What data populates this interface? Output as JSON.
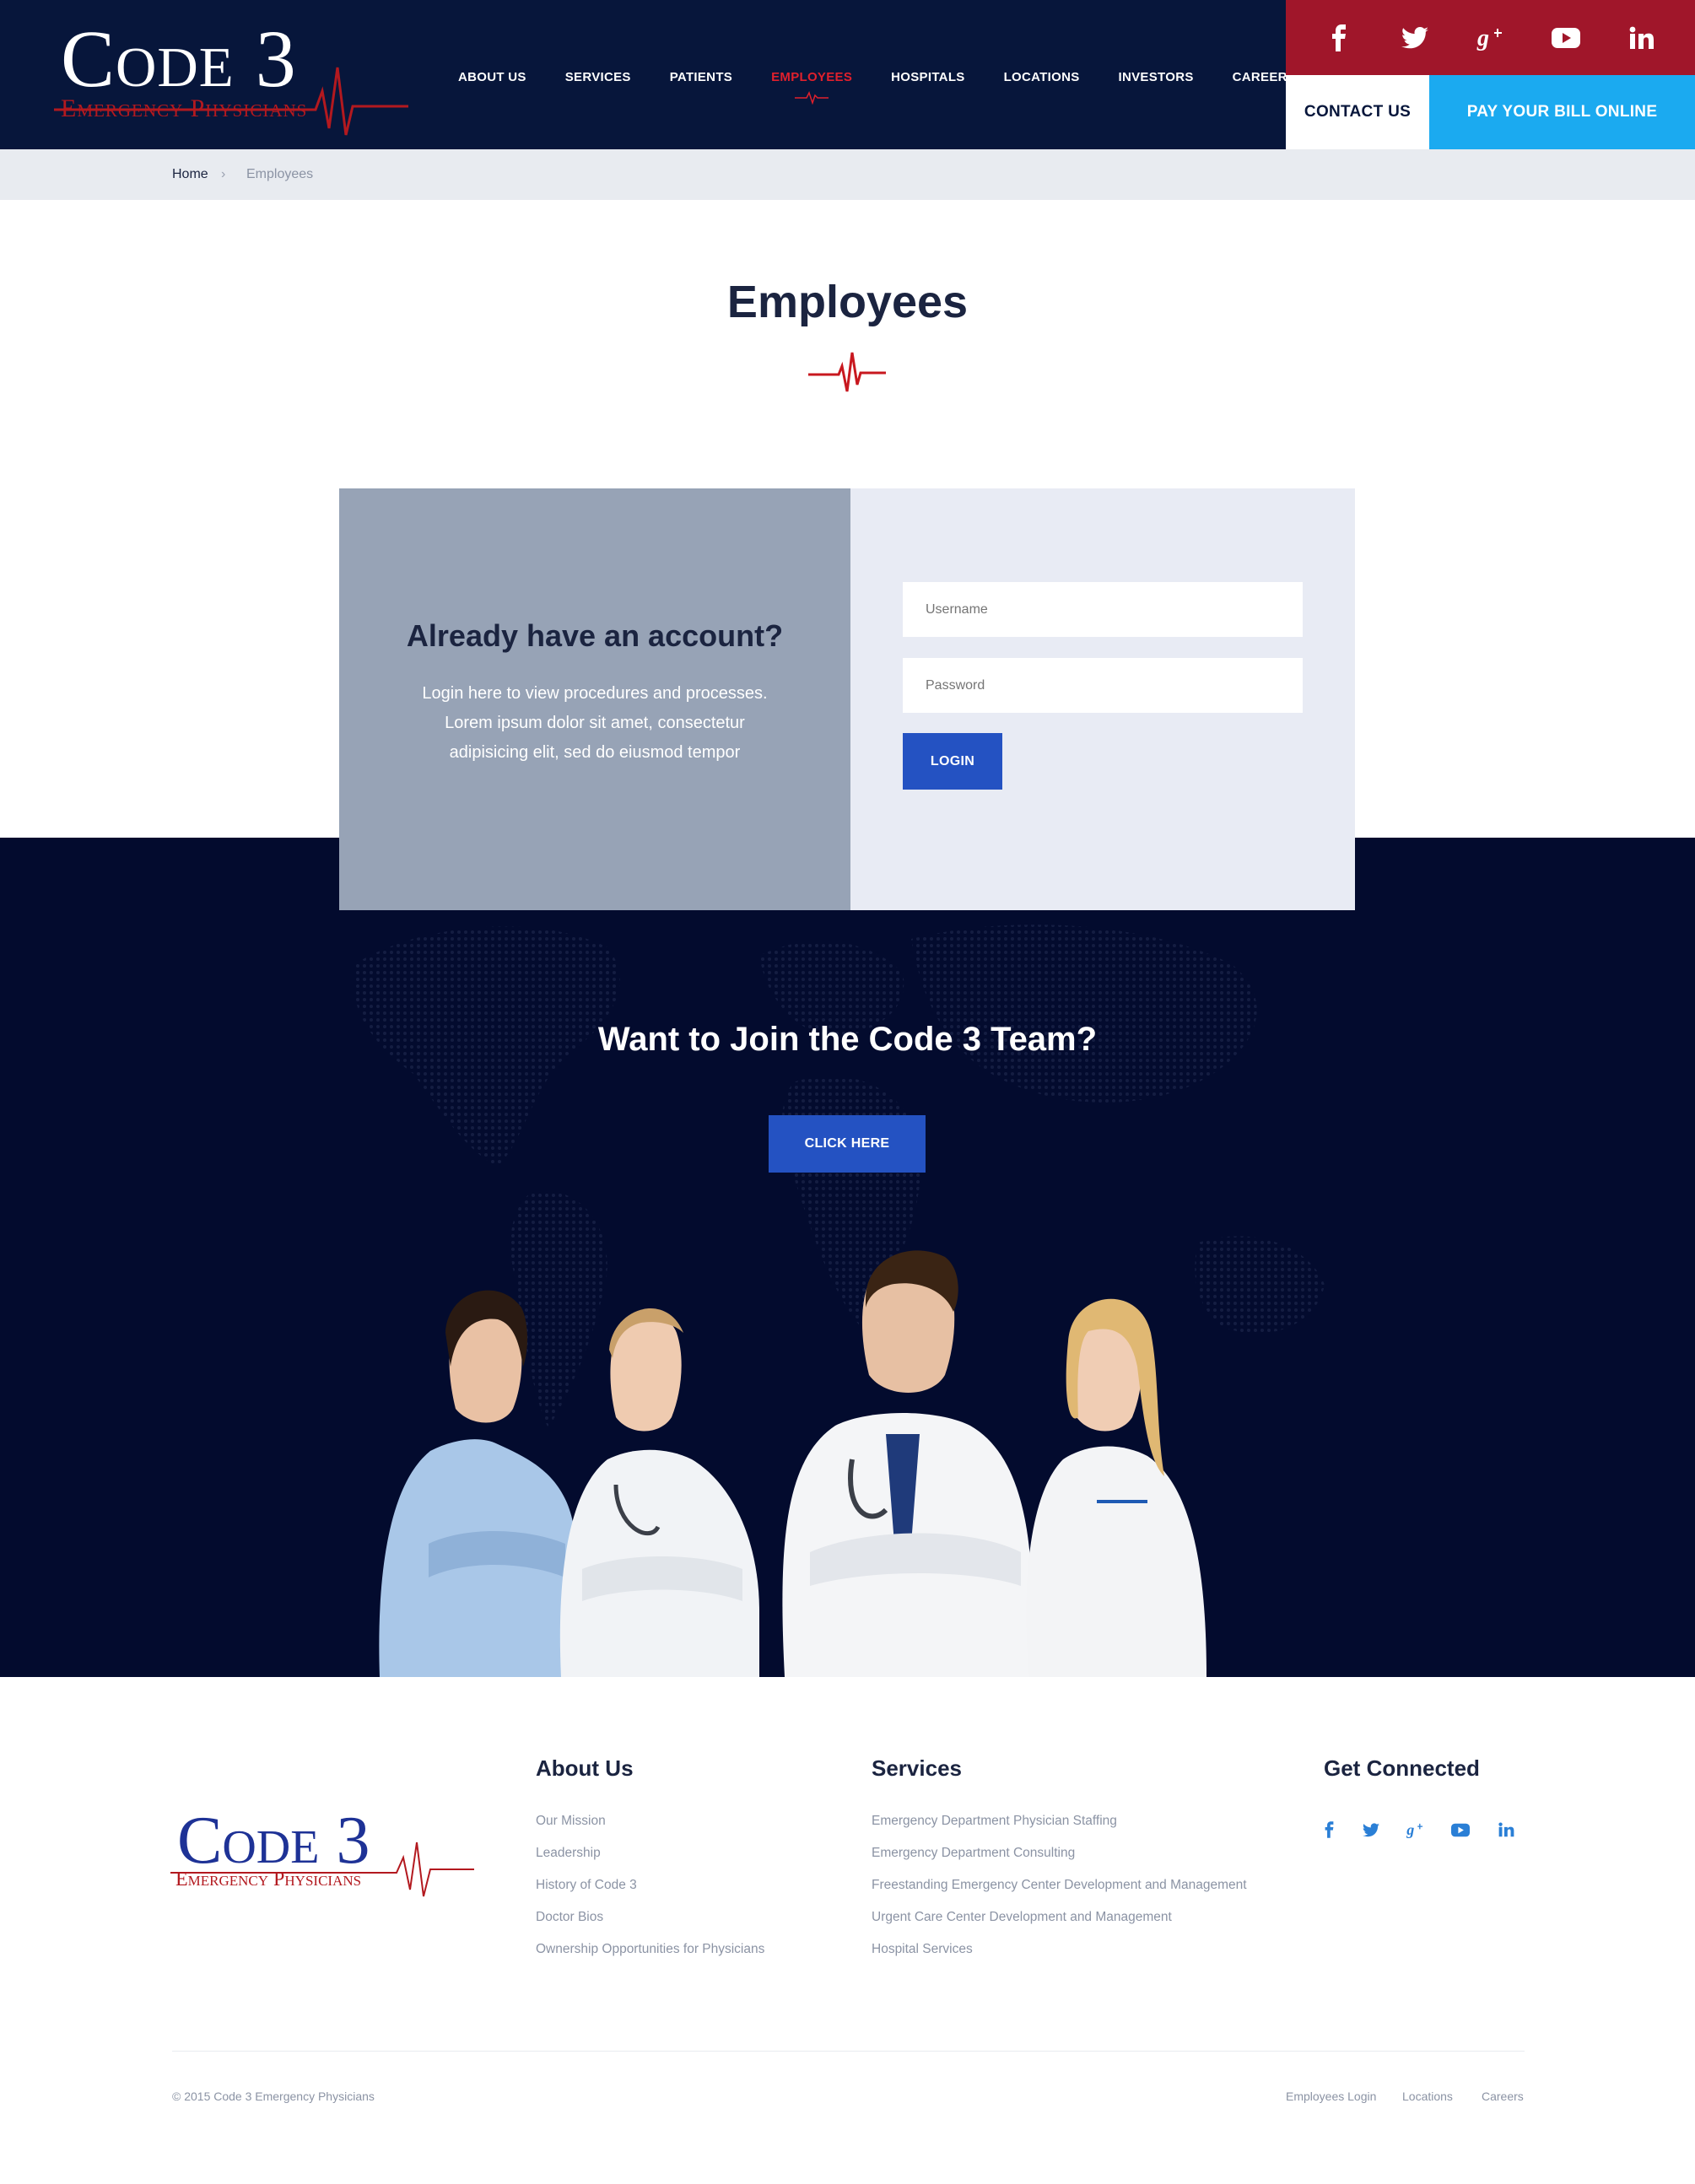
{
  "header": {
    "logo_title": "Code 3",
    "logo_subtitle": "Emergency Physicians",
    "nav": [
      {
        "label": "ABOUT US"
      },
      {
        "label": "SERVICES"
      },
      {
        "label": "PATIENTS"
      },
      {
        "label": "EMPLOYEES",
        "active": true
      },
      {
        "label": "HOSPITALS"
      },
      {
        "label": "LOCATIONS"
      },
      {
        "label": "INVESTORS"
      },
      {
        "label": "CAREERS"
      }
    ],
    "social": [
      {
        "icon": "facebook-icon",
        "glyph": "f"
      },
      {
        "icon": "twitter-icon",
        "glyph": "t"
      },
      {
        "icon": "google-plus-icon",
        "glyph": "g+"
      },
      {
        "icon": "youtube-icon",
        "glyph": "▶"
      },
      {
        "icon": "linkedin-icon",
        "glyph": "in"
      }
    ],
    "contact_label": "CONTACT US",
    "pay_label": "PAY YOUR BILL ONLINE"
  },
  "breadcrumb": {
    "home": "Home",
    "separator": "›",
    "current": "Employees"
  },
  "page": {
    "title": "Employees"
  },
  "login": {
    "heading": "Already have an account?",
    "text": "Login here to view procedures and processes. Lorem ipsum dolor sit amet, consectetur adipisicing elit, sed do eiusmod tempor",
    "username_placeholder": "Username",
    "password_placeholder": "Password",
    "button": "LOGIN"
  },
  "join": {
    "title": "Want to Join the Code 3 Team?",
    "button": "CLICK HERE"
  },
  "footer": {
    "logo_title": "Code 3",
    "logo_subtitle": "Emergency Physicians",
    "about": {
      "title": "About Us",
      "links": [
        "Our Mission",
        "Leadership",
        "History of Code 3",
        "Doctor Bios",
        "Ownership Opportunities for Physicians"
      ]
    },
    "services": {
      "title": "Services",
      "links": [
        "Emergency Department Physician Staffing",
        "Emergency Department Consulting",
        "Freestanding Emergency Center Development and Management",
        "Urgent Care Center Development and Management",
        "Hospital Services"
      ]
    },
    "connected": {
      "title": "Get Connected"
    },
    "copyright": "© 2015 Code 3 Emergency Physicians",
    "bottom_links": [
      "Employees Login",
      "Locations",
      "Careers"
    ]
  },
  "colors": {
    "navy": "#07163b",
    "dark_section": "#030b2e",
    "red": "#a0162a",
    "accent_red": "#e0202c",
    "sky_blue": "#1baaf0",
    "button_blue": "#2452c2"
  }
}
